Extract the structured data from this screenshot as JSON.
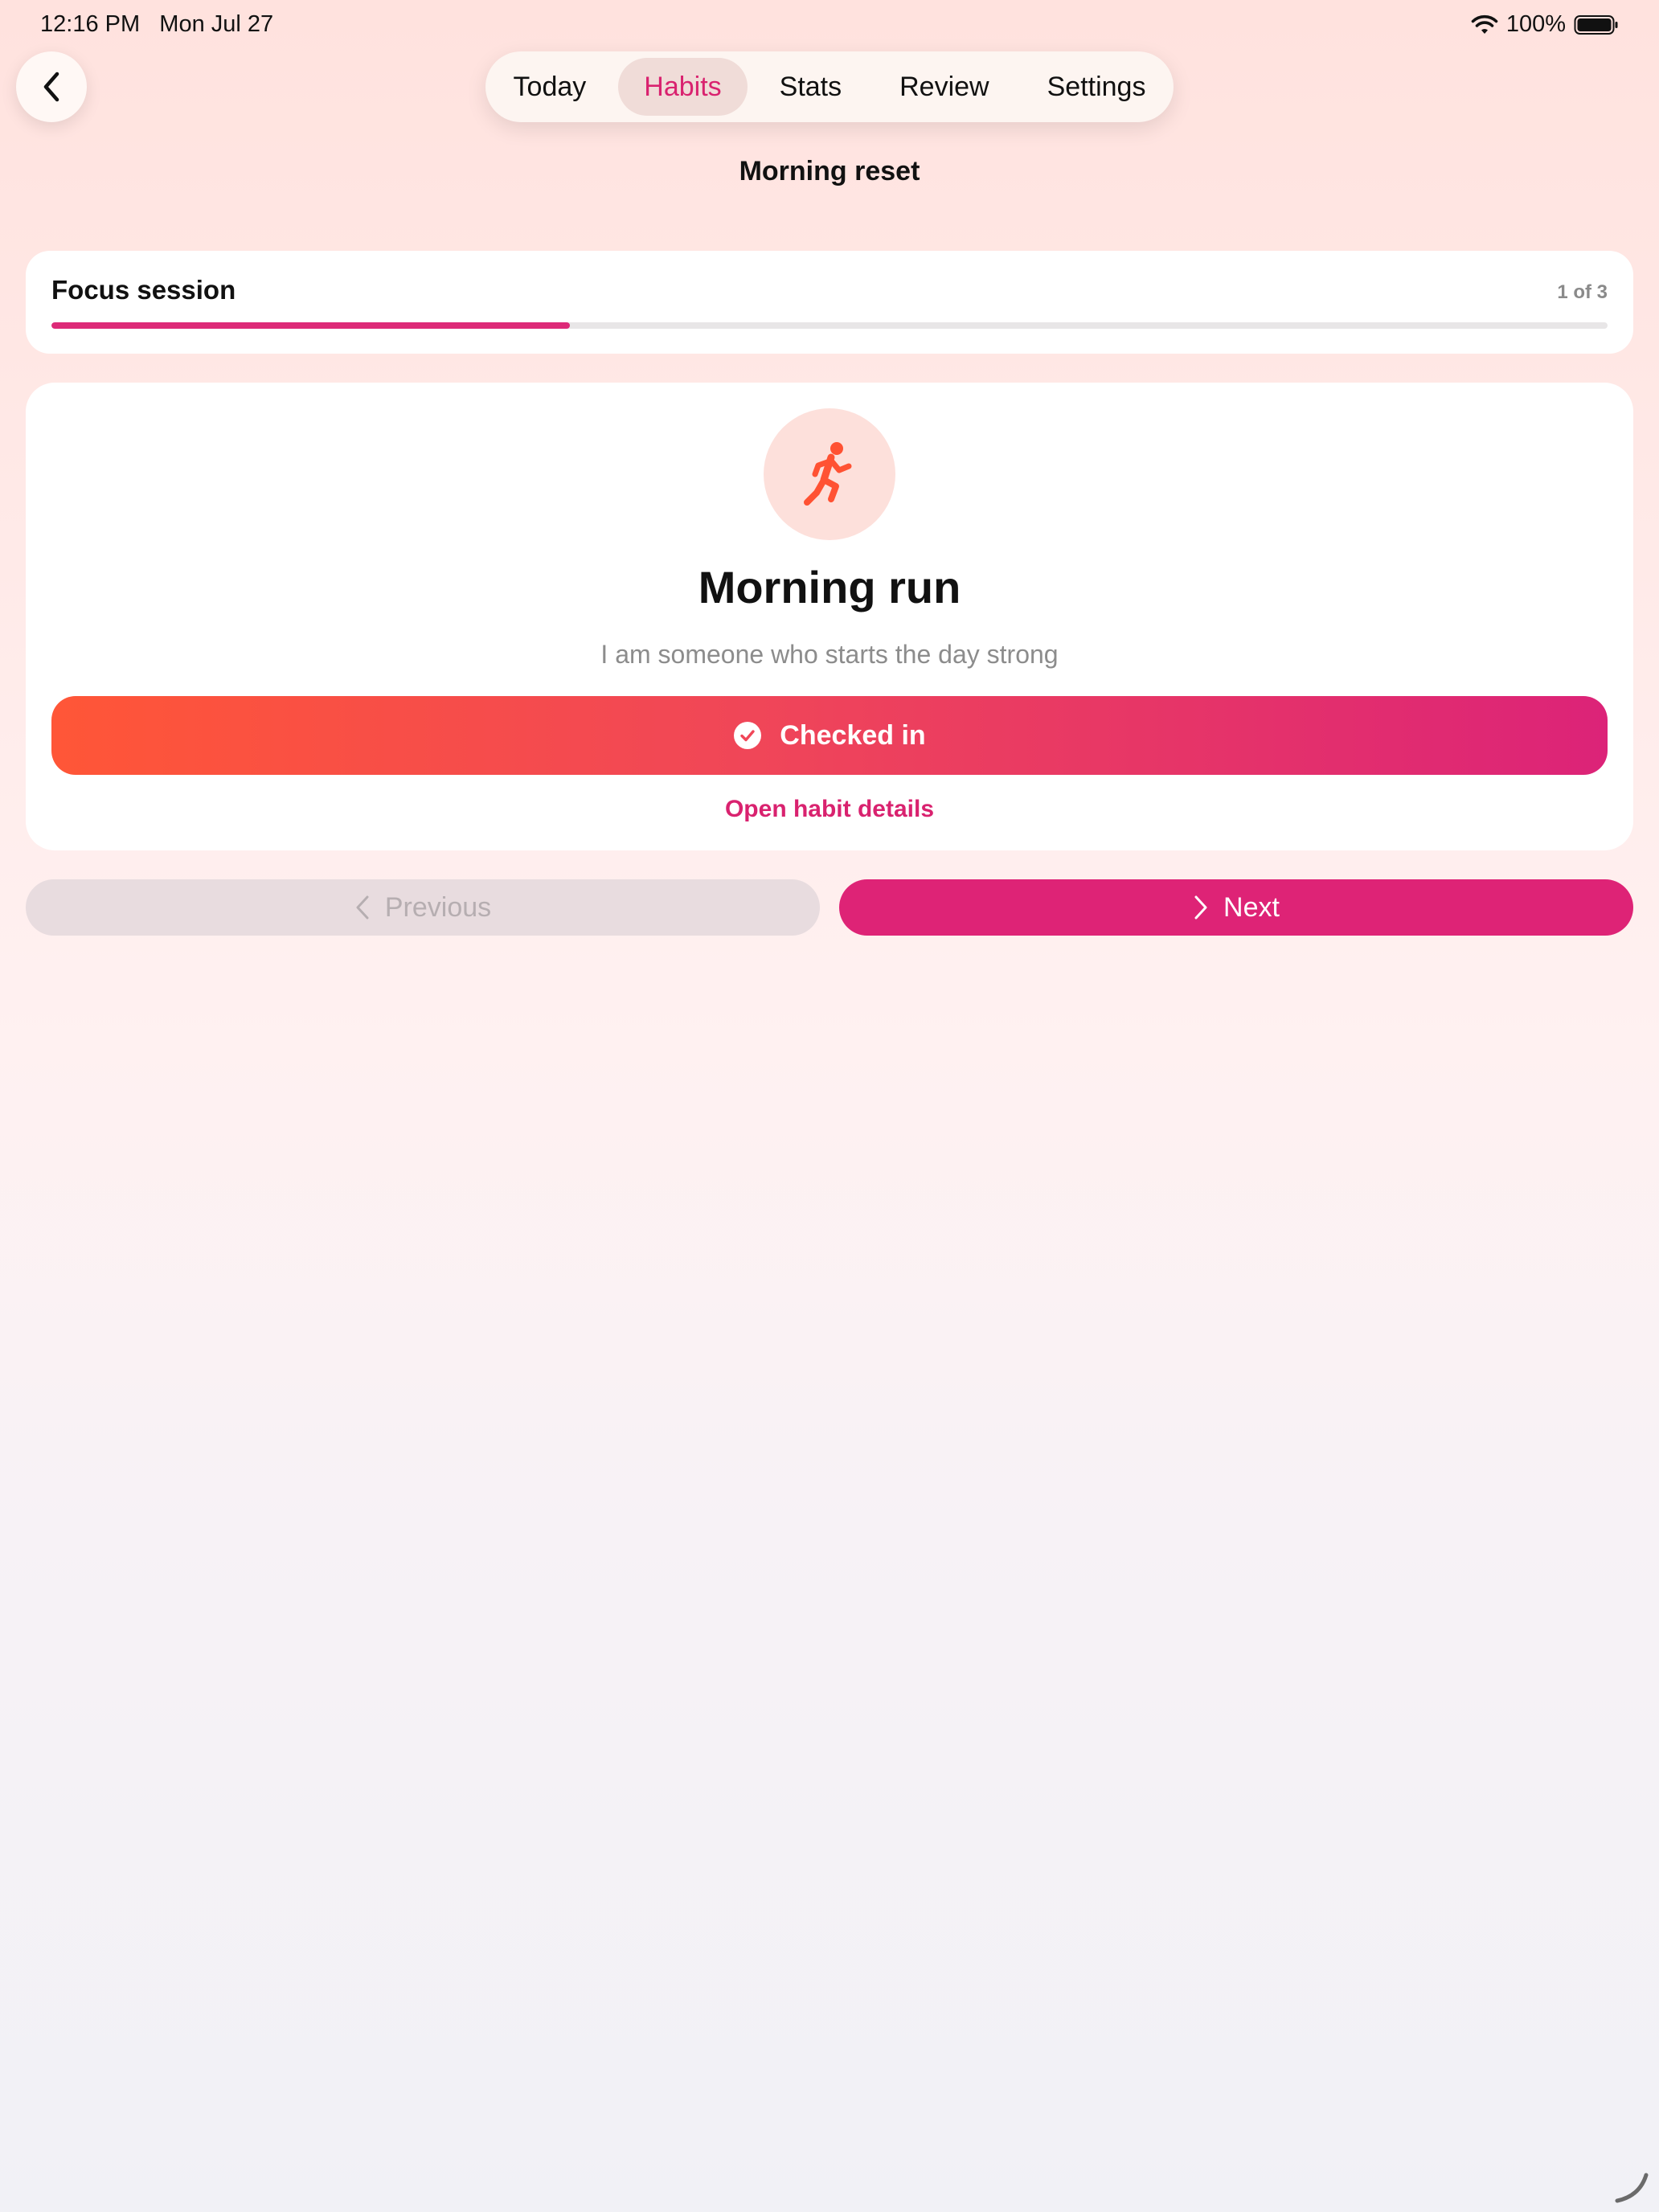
{
  "status_bar": {
    "time": "12:16 PM   Mon Jul 27",
    "battery": "100%",
    "icons": [
      "wifi-icon",
      "battery-icon"
    ]
  },
  "header": {
    "back_icon": "chevron-left-icon",
    "tabs": [
      {
        "label": "Today",
        "active": false
      },
      {
        "label": "Habits",
        "active": true
      },
      {
        "label": "Stats",
        "active": false
      },
      {
        "label": "Review",
        "active": false
      },
      {
        "label": "Settings",
        "active": false
      }
    ],
    "title": "Morning reset"
  },
  "session": {
    "title": "Focus session",
    "count": "1 of 3",
    "progress_fraction": 0.3333,
    "accent_color": "#dd2a78"
  },
  "habit": {
    "icon": "running-figure-icon",
    "icon_color": "#ff5233",
    "name": "Morning run",
    "identity": "I am someone who starts the day strong",
    "checkin_label": "Checked in",
    "checkin_icon": "checkmark-circle-icon",
    "details_link": "Open habit details"
  },
  "navigation": {
    "previous_label": "Previous",
    "previous_enabled": false,
    "next_label": "Next",
    "next_enabled": true
  },
  "colors": {
    "brand": "#de2376",
    "gradient_start": "#ff5637",
    "gradient_end": "#dc2378"
  }
}
